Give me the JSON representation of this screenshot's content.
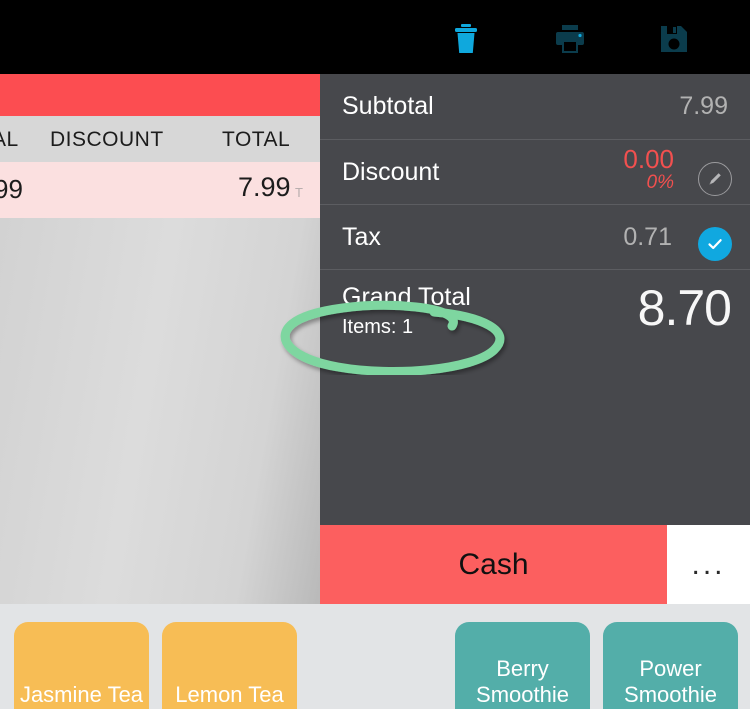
{
  "toolbar": {
    "icons": [
      {
        "name": "trash-icon",
        "label": "Delete",
        "color": "#0fa8dd"
      },
      {
        "name": "print-icon",
        "label": "Print",
        "color": "#0b3c4c"
      },
      {
        "name": "save-icon",
        "label": "Save",
        "color": "#0b3c4c"
      }
    ],
    "background": "#000000"
  },
  "cart": {
    "columns": [
      "AL",
      "DISCOUNT",
      "TOTAL"
    ],
    "row": {
      "quantity_fragment": "99",
      "total": "7.99",
      "tax_flag": "T"
    },
    "accent_red": "#fc4d51",
    "row_background": "#fbe0e0",
    "header_background": "#d7d7d7"
  },
  "totals": {
    "subtotal_label": "Subtotal",
    "subtotal_value": "7.99",
    "discount_label": "Discount",
    "discount_amount": "0.00",
    "discount_percent": "0%",
    "discount_edit_icon": "pencil-icon",
    "tax_label": "Tax",
    "tax_value": "0.71",
    "tax_check_icon": "check-icon",
    "grand_total_label": "Grand Total",
    "items_label": "Items: 1",
    "grand_total_value": "8.70",
    "panel_background": "#47484c",
    "discount_color": "#f2504f",
    "check_color": "#10a8e0"
  },
  "pay": {
    "cash_label": "Cash",
    "more_label": "...",
    "cash_color": "#fc5f5f"
  },
  "products": [
    {
      "label": "Jasmine Tea",
      "color": "#f7bd55",
      "style": "orange"
    },
    {
      "label": "Lemon Tea",
      "color": "#f7bd55",
      "style": "orange"
    },
    {
      "label": "Berry Smoothie",
      "color": "#53aea9",
      "style": "teal"
    },
    {
      "label": "Power Smoothie",
      "color": "#53aea9",
      "style": "teal"
    }
  ],
  "annotation": {
    "shape": "hand-drawn-ellipse",
    "color": "#7ed6a0",
    "target": "Items: 1"
  }
}
